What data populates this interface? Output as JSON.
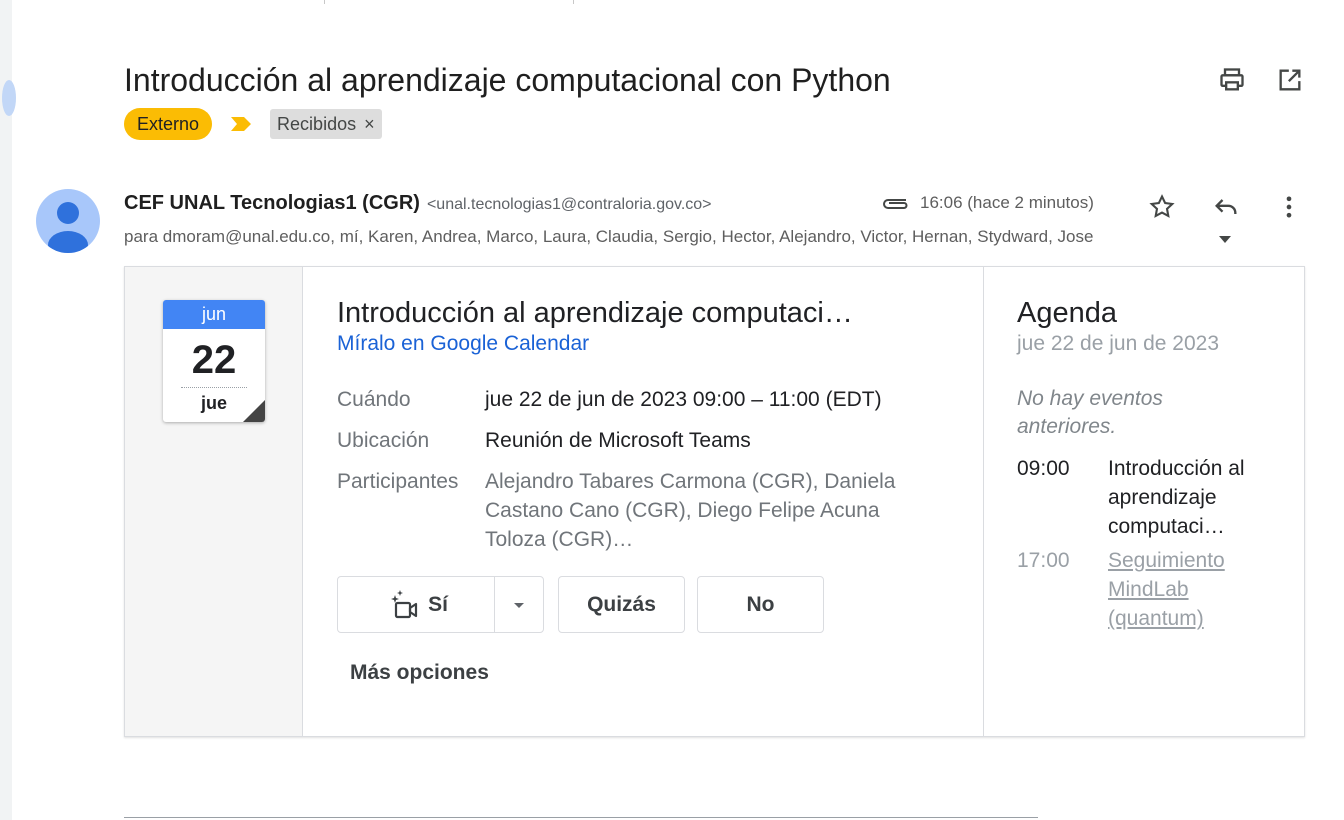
{
  "message": {
    "subject": "Introducción al aprendizaje computacional con Python",
    "labels": {
      "external": "Externo",
      "inbox": "Recibidos",
      "inbox_remove": "×"
    },
    "sender": {
      "name": "CEF UNAL Tecnologias1 (CGR)",
      "email": "<unal.tecnologias1@contraloria.gov.co>"
    },
    "time": "16:06 (hace 2 minutos)",
    "recipients": "para dmoram@unal.edu.co, mí, Karen, Andrea, Marco, Laura, Claudia, Sergio, Hector, Alejandro, Victor, Hernan, Stydward, Jose"
  },
  "icons": {
    "print": "print-icon",
    "open_new": "open-in-new-window-icon",
    "attachment": "paperclip-icon",
    "star": "star-icon",
    "reply": "reply-icon",
    "more": "more-vert-icon",
    "expand": "caret-down-icon",
    "avatar": "person-icon",
    "meet": "video-camera-sparkle-icon"
  },
  "calendar": {
    "month": "jun",
    "day": "22",
    "weekday": "jue",
    "colors": {
      "header": "#4285f4",
      "label_external": "#fbbc04",
      "link": "#1a62d6"
    }
  },
  "event": {
    "title": "Introducción al aprendizaje computaci…",
    "view_link": "Míralo en Google Calendar",
    "when_label": "Cuándo",
    "when_value": "jue 22 de jun de 2023 09:00 – 11:00 (EDT)",
    "location_label": "Ubicación",
    "location_value": "Reunión de Microsoft Teams",
    "participants_label": "Participantes",
    "participants_value": "Alejandro Tabares Carmona (CGR), Daniela Castano Cano (CGR), Diego Felipe Acuna Toloza (CGR)…",
    "rsvp": {
      "yes": "Sí",
      "maybe": "Quizás",
      "no": "No"
    },
    "more_options": "Más opciones"
  },
  "agenda": {
    "title": "Agenda",
    "date": "jue 22 de jun de 2023",
    "no_previous": "No hay eventos anteriores.",
    "events": [
      {
        "time": "09:00",
        "name": "Introducción al aprendizaje computaci…"
      },
      {
        "time": "17:00",
        "name": "Seguimiento MindLab (quantum)"
      }
    ]
  }
}
